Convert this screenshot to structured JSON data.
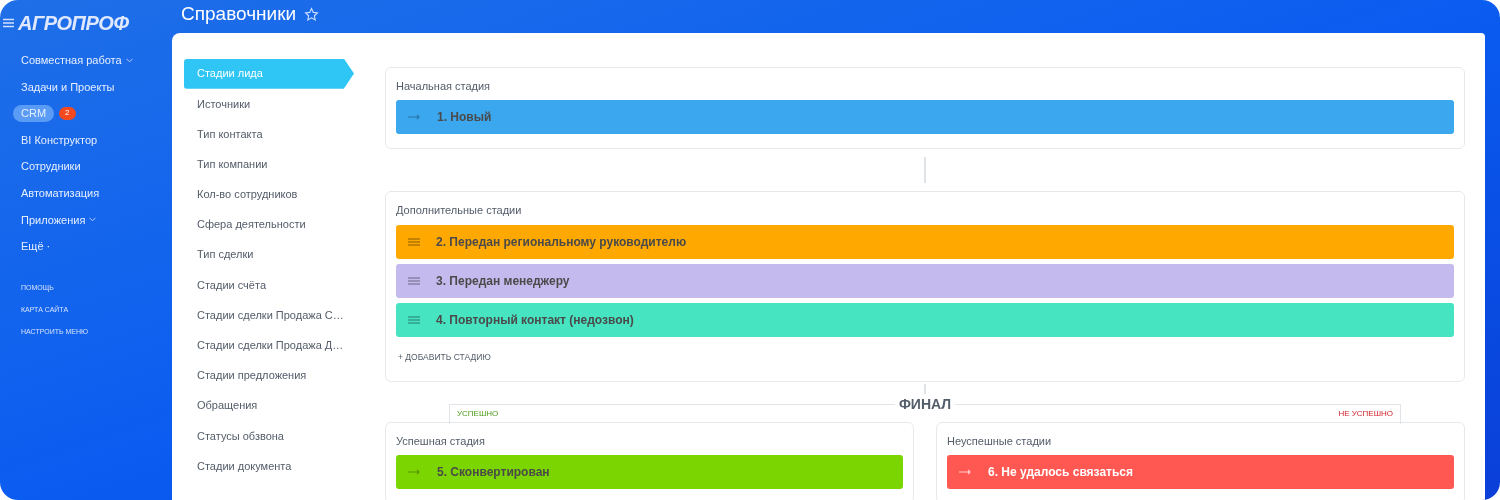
{
  "header": {
    "logo": "АГРОПРОФ",
    "title": "Справочники"
  },
  "sidebar": {
    "items": [
      {
        "label": "Совместная работа",
        "selected": false,
        "expandable": true
      },
      {
        "label": "Задачи и Проекты",
        "selected": false,
        "expandable": false
      },
      {
        "label": "CRM",
        "selected": true,
        "expandable": false,
        "badge": "2"
      },
      {
        "label": "BI Конструктор",
        "selected": false,
        "expandable": false
      },
      {
        "label": "Сотрудники",
        "selected": false,
        "expandable": false
      },
      {
        "label": "Автоматизация",
        "selected": false,
        "expandable": false
      },
      {
        "label": "Приложения",
        "selected": false,
        "expandable": true
      },
      {
        "label": "Ещё ·",
        "selected": false,
        "expandable": false
      }
    ],
    "links": [
      "ПОМОЩЬ",
      "КАРТА САЙТА",
      "НАСТРОИТЬ МЕНЮ"
    ]
  },
  "dictionaries": [
    {
      "label": "Стадии лида",
      "selected": true
    },
    {
      "label": "Источники",
      "selected": false
    },
    {
      "label": "Тип контакта",
      "selected": false
    },
    {
      "label": "Тип компании",
      "selected": false
    },
    {
      "label": "Кол-во сотрудников",
      "selected": false
    },
    {
      "label": "Сфера деятельности",
      "selected": false
    },
    {
      "label": "Тип сделки",
      "selected": false
    },
    {
      "label": "Стадии счёта",
      "selected": false
    },
    {
      "label": "Стадии сделки Продажа С…",
      "selected": false
    },
    {
      "label": "Стадии сделки Продажа Д…",
      "selected": false
    },
    {
      "label": "Стадии предложения",
      "selected": false
    },
    {
      "label": "Обращения",
      "selected": false
    },
    {
      "label": "Статусы обзвона",
      "selected": false
    },
    {
      "label": "Стадии документа",
      "selected": false
    }
  ],
  "initial": {
    "title": "Начальная стадия",
    "stages": [
      {
        "kind": "fixed",
        "name": "1. Новый",
        "color": "#3ba7ee"
      }
    ]
  },
  "additional": {
    "title": "Дополнительные стадии",
    "stages": [
      {
        "kind": "draggable",
        "name": "2. Передан региональному руководителю",
        "color": "#ffa800"
      },
      {
        "kind": "draggable",
        "name": "3. Передан менеджеру",
        "color": "#c4baed"
      },
      {
        "kind": "draggable",
        "name": "4. Повторный контакт (недозвон)",
        "color": "#47e4c2"
      }
    ],
    "add_button": "+ ДОБАВИТЬ СТАДИЮ"
  },
  "final": {
    "title": "ФИНАЛ",
    "success_label": "УСПЕШНО",
    "fail_label": "НЕ УСПЕШНО",
    "success": {
      "title": "Успешная стадия",
      "stages": [
        {
          "kind": "fixed",
          "name": "5. Сконвертирован",
          "color": "#7bd500"
        }
      ]
    },
    "fail": {
      "title": "Неуспешные стадии",
      "stages": [
        {
          "kind": "fixed",
          "name": "6. Не удалось связаться",
          "color": "#ff5752",
          "light_text": true
        }
      ]
    }
  }
}
